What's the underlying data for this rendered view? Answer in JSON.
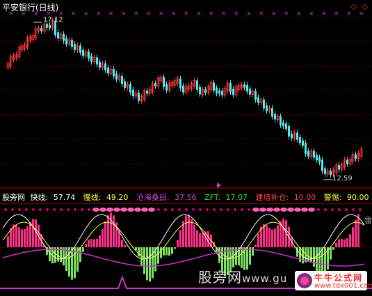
{
  "window": {
    "title": "平安银行(日线)",
    "corner_icons": "◇ ◇"
  },
  "price_panel": {
    "high_label": "17.12",
    "low_label": "12.59"
  },
  "indicator_bar": {
    "name": "股旁网",
    "items": [
      {
        "label": "快线:",
        "value": "57.74",
        "color": "#ffffff"
      },
      {
        "label": "慢线:",
        "value": "49.20",
        "color": "#ffff33"
      },
      {
        "label": "沧海桑田:",
        "value": "37.56",
        "color": "#cc44cc"
      },
      {
        "label": "ZFT:",
        "value": "17.07",
        "color": "#33dd33"
      },
      {
        "label": "建增补仓:",
        "value": "10.00",
        "color": "#ff4444"
      },
      {
        "label": "警惕:",
        "value": "90.00",
        "color": "#ffff33"
      }
    ]
  },
  "side_glyph": "雷",
  "watermark": {
    "left": "股旁网",
    "left_tail": "www.gu",
    "right_title": "牛牛公式网",
    "right_url": "www.tdx001.com"
  },
  "colors": {
    "up": "#ff3a3a",
    "down": "#55e7ee",
    "pink": "#ff2e8a",
    "green": "#7ee060",
    "magenta_line": "#d22fd2"
  }
}
